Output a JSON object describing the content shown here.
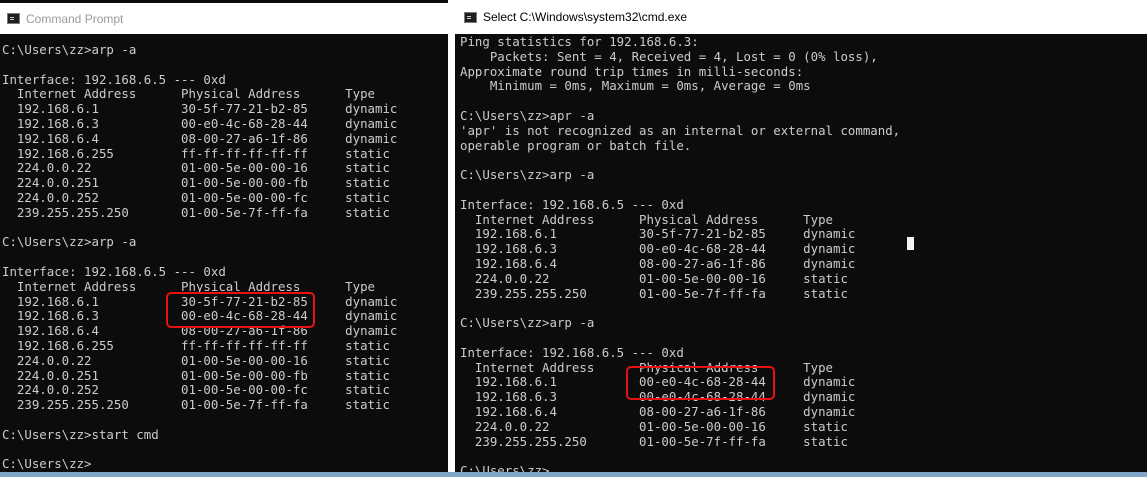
{
  "left_window": {
    "title": "Command Prompt",
    "lines": [
      "C:\\Users\\zz>arp -a",
      "",
      "Interface: 192.168.6.5 --- 0xd",
      "  Internet Address      Physical Address      Type",
      "  192.168.6.1           30-5f-77-21-b2-85     dynamic",
      "  192.168.6.3           00-e0-4c-68-28-44     dynamic",
      "  192.168.6.4           08-00-27-a6-1f-86     dynamic",
      "  192.168.6.255         ff-ff-ff-ff-ff-ff     static",
      "  224.0.0.22            01-00-5e-00-00-16     static",
      "  224.0.0.251           01-00-5e-00-00-fb     static",
      "  224.0.0.252           01-00-5e-00-00-fc     static",
      "  239.255.255.250       01-00-5e-7f-ff-fa     static",
      "",
      "C:\\Users\\zz>arp -a",
      "",
      "Interface: 192.168.6.5 --- 0xd",
      "  Internet Address      Physical Address      Type",
      "  192.168.6.1           30-5f-77-21-b2-85     dynamic",
      "  192.168.6.3           00-e0-4c-68-28-44     dynamic",
      "  192.168.6.4           08-00-27-a6-1f-86     dynamic",
      "  192.168.6.255         ff-ff-ff-ff-ff-ff     static",
      "  224.0.0.22            01-00-5e-00-00-16     static",
      "  224.0.0.251           01-00-5e-00-00-fb     static",
      "  224.0.0.252           01-00-5e-00-00-fc     static",
      "  239.255.255.250       01-00-5e-7f-ff-fa     static",
      "",
      "C:\\Users\\zz>start cmd",
      "",
      "C:\\Users\\zz>"
    ]
  },
  "right_window": {
    "title": "Select C:\\Windows\\system32\\cmd.exe",
    "lines": [
      "Ping statistics for 192.168.6.3:",
      "    Packets: Sent = 4, Received = 4, Lost = 0 (0% loss),",
      "Approximate round trip times in milli-seconds:",
      "    Minimum = 0ms, Maximum = 0ms, Average = 0ms",
      "",
      "C:\\Users\\zz>apr -a",
      "'apr' is not recognized as an internal or external command,",
      "operable program or batch file.",
      "",
      "C:\\Users\\zz>arp -a",
      "",
      "Interface: 192.168.6.5 --- 0xd",
      "  Internet Address      Physical Address      Type",
      "  192.168.6.1           30-5f-77-21-b2-85     dynamic",
      "  192.168.6.3           00-e0-4c-68-28-44     dynamic",
      "  192.168.6.4           08-00-27-a6-1f-86     dynamic",
      "  224.0.0.22            01-00-5e-00-00-16     static",
      "  239.255.255.250       01-00-5e-7f-ff-fa     static",
      "",
      "C:\\Users\\zz>arp -a",
      "",
      "Interface: 192.168.6.5 --- 0xd",
      "  Internet Address      Physical Address      Type",
      "  192.168.6.1           00-e0-4c-68-28-44     dynamic",
      "  192.168.6.3           00-e0-4c-68-28-44     dynamic",
      "  192.168.6.4           08-00-27-a6-1f-86     dynamic",
      "  224.0.0.22            01-00-5e-00-00-16     static",
      "  239.255.255.250       01-00-5e-7f-ff-fa     static",
      "",
      "C:\\Users\\zz>"
    ]
  },
  "icons": {
    "window_icon": "cmd-icon"
  },
  "colors": {
    "console_bg": "#0c0c0c",
    "console_fg": "#cccccc",
    "highlight": "#e81010",
    "titlebar_bg": "#ffffff"
  }
}
